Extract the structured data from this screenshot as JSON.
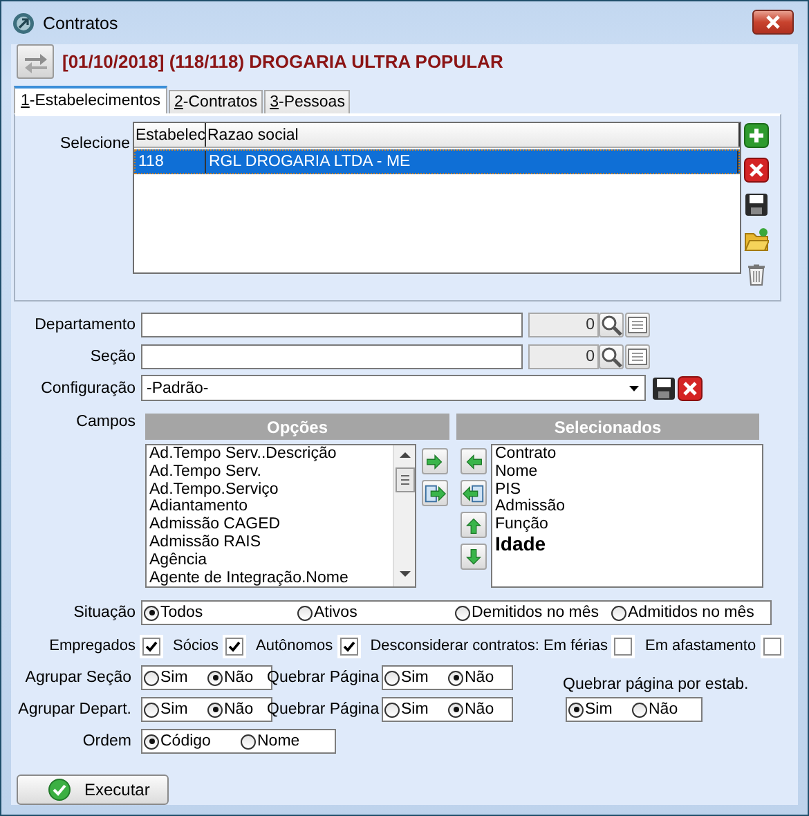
{
  "window": {
    "title": "Contratos"
  },
  "header": {
    "title": "[01/10/2018] (118/118) DROGARIA ULTRA POPULAR"
  },
  "tabs": [
    {
      "label": "1-Estabelecimentos",
      "selected": true
    },
    {
      "label": "2-Contratos",
      "selected": false
    },
    {
      "label": "3-Pessoas",
      "selected": false
    }
  ],
  "establishments": {
    "label": "Selecione",
    "columns": [
      "Estabelec",
      "Razao social"
    ],
    "rows": [
      {
        "cells": [
          "118",
          "RGL DROGARIA LTDA - ME"
        ],
        "selected": true
      }
    ]
  },
  "departamento": {
    "label": "Departamento",
    "code": "0"
  },
  "secao": {
    "label": "Seção",
    "code": "0"
  },
  "configuracao": {
    "label": "Configuração",
    "value": "-Padrão-"
  },
  "campos": {
    "label": "Campos",
    "options_title": "Opções",
    "options": [
      "Ad.Tempo Serv..Descrição",
      "Ad.Tempo Serv.",
      "Ad.Tempo.Serviço",
      "Adiantamento",
      "Admissão CAGED",
      "Admissão RAIS",
      "Agência",
      "Agente de Integração.Nome"
    ],
    "selected_title": "Selecionados",
    "selected_fields": [
      {
        "text": "Contrato",
        "highlighted": false
      },
      {
        "text": "Nome",
        "highlighted": false
      },
      {
        "text": "PIS",
        "highlighted": false
      },
      {
        "text": "Admissão",
        "highlighted": false
      },
      {
        "text": "Função",
        "highlighted": false
      },
      {
        "text": "Idade",
        "highlighted": true
      }
    ]
  },
  "situacao": {
    "label": "Situação",
    "options": [
      {
        "label": "Todos",
        "selected": true
      },
      {
        "label": "Ativos",
        "selected": false
      },
      {
        "label": "Demitidos no mês",
        "selected": false
      },
      {
        "label": "Admitidos no mês",
        "selected": false
      }
    ]
  },
  "filters": [
    {
      "label": "Empregados",
      "checked": true
    },
    {
      "label": "Sócios",
      "checked": true
    },
    {
      "label": "Autônomos",
      "checked": true
    },
    {
      "label": "Desconsiderar contratos: Em férias",
      "checked": false
    },
    {
      "label": "Em afastamento",
      "checked": false
    }
  ],
  "agrupar_secao": {
    "label": "Agrupar Seção",
    "options": [
      {
        "label": "Sim",
        "selected": false
      },
      {
        "label": "Não",
        "selected": true
      }
    ]
  },
  "quebrar_secao": {
    "label": "Quebrar Página",
    "options": [
      {
        "label": "Sim",
        "selected": false
      },
      {
        "label": "Não",
        "selected": true
      }
    ]
  },
  "agrupar_depart": {
    "label": "Agrupar Depart.",
    "options": [
      {
        "label": "Sim",
        "selected": false
      },
      {
        "label": "Não",
        "selected": true
      }
    ]
  },
  "quebrar_depart": {
    "label": "Quebrar Página",
    "options": [
      {
        "label": "Sim",
        "selected": false
      },
      {
        "label": "Não",
        "selected": true
      }
    ]
  },
  "quebrar_estab": {
    "label": "Quebrar página por estab.",
    "options": [
      {
        "label": "Sim",
        "selected": true
      },
      {
        "label": "Não",
        "selected": false
      }
    ]
  },
  "ordem": {
    "label": "Ordem",
    "options": [
      {
        "label": "Código",
        "selected": true
      },
      {
        "label": "Nome",
        "selected": false
      }
    ]
  },
  "run_button": {
    "label": "Executar"
  }
}
